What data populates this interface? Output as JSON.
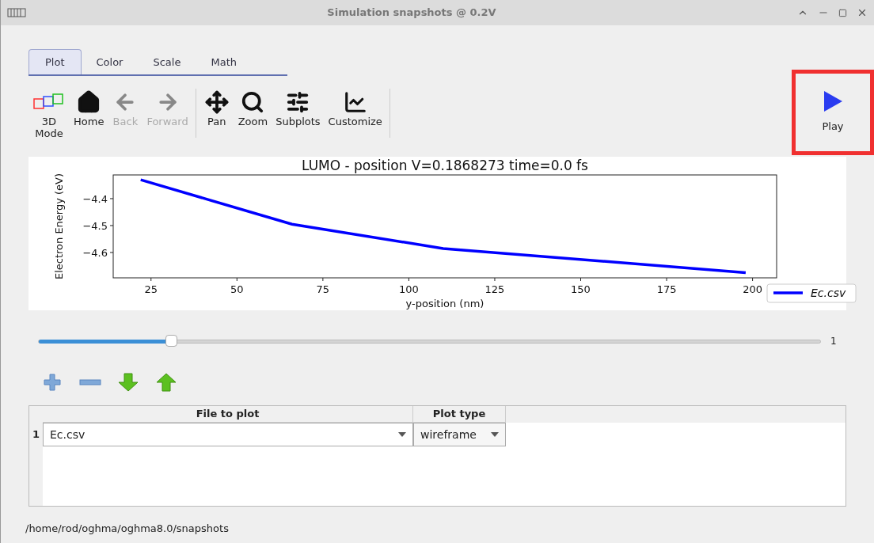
{
  "window": {
    "title": "Simulation snapshots @ 0.2V"
  },
  "tabs": [
    {
      "label": "Plot",
      "selected": true
    },
    {
      "label": "Color",
      "selected": false
    },
    {
      "label": "Scale",
      "selected": false
    },
    {
      "label": "Math",
      "selected": false
    }
  ],
  "toolbar": [
    {
      "kind": "cubes",
      "label": "3D\nMode",
      "disabled": false
    },
    {
      "kind": "home",
      "label": "Home",
      "disabled": false
    },
    {
      "kind": "back",
      "label": "Back",
      "disabled": true
    },
    {
      "kind": "forward",
      "label": "Forward",
      "disabled": true
    },
    {
      "kind": "pan",
      "label": "Pan",
      "disabled": false
    },
    {
      "kind": "zoom",
      "label": "Zoom",
      "disabled": false
    },
    {
      "kind": "subplots",
      "label": "Subplots",
      "disabled": false
    },
    {
      "kind": "customize",
      "label": "Customize",
      "disabled": false
    }
  ],
  "play_button": {
    "label": "Play",
    "highlighted": true
  },
  "chart": {
    "chart_data": {
      "type": "line",
      "title": "LUMO - position V=0.1868273 time=0.0 fs",
      "xlabel": "y-position (nm)",
      "ylabel": "Electron Energy (eV)",
      "x": [
        22,
        66,
        110,
        198
      ],
      "series": [
        {
          "name": "Ec.csv",
          "color": "#0000ff",
          "values": [
            -4.33,
            -4.495,
            -4.585,
            -4.675
          ]
        }
      ],
      "xlim": [
        14,
        207
      ],
      "ylim": [
        -4.694,
        -4.312
      ],
      "xticks": [
        25,
        50,
        75,
        100,
        125,
        150,
        175,
        200
      ],
      "yticks": [
        {
          "value": -4.4,
          "label": "−4.4"
        },
        {
          "value": -4.5,
          "label": "−4.5"
        },
        {
          "value": -4.6,
          "label": "−4.6"
        }
      ]
    }
  },
  "slider": {
    "level": 0.17,
    "max_label": "1"
  },
  "list_tools": [
    {
      "kind": "add"
    },
    {
      "kind": "remove"
    },
    {
      "kind": "down"
    },
    {
      "kind": "up"
    }
  ],
  "table": {
    "columns": [
      "File to plot",
      "Plot type"
    ],
    "rows": [
      {
        "index": "1",
        "file": "Ec.csv",
        "plot_type": "wireframe"
      }
    ]
  },
  "status_bar": "/home/rod/oghma/oghma8.0/snapshots"
}
